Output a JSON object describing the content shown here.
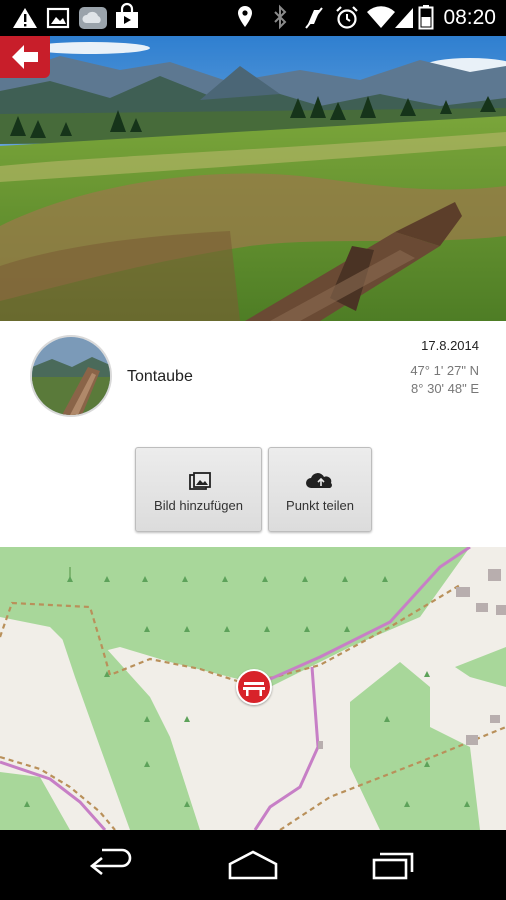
{
  "status_bar": {
    "time": "08:20",
    "icons": [
      "warning-icon",
      "image-icon",
      "cloud-icon",
      "shopping-bag-icon",
      "location-icon",
      "bluetooth-icon",
      "mute-icon",
      "alarm-icon",
      "wifi-icon",
      "signal-icon",
      "battery-icon"
    ]
  },
  "detail": {
    "name": "Tontaube",
    "date": "17.8.2014",
    "latitude": "47° 1' 27\" N",
    "longitude": "8° 30' 48\" E"
  },
  "actions": {
    "add_image_label": "Bild hinzufügen",
    "share_point_label": "Punkt teilen"
  },
  "colors": {
    "accent": "#c81e2a",
    "map_background": "#f1eee8",
    "map_forest": "#a5d68e",
    "map_path": "#b9905a",
    "map_road": "#c77fc6"
  },
  "navigation": {
    "icons": [
      "back-icon",
      "home-icon",
      "recent-apps-icon"
    ]
  }
}
